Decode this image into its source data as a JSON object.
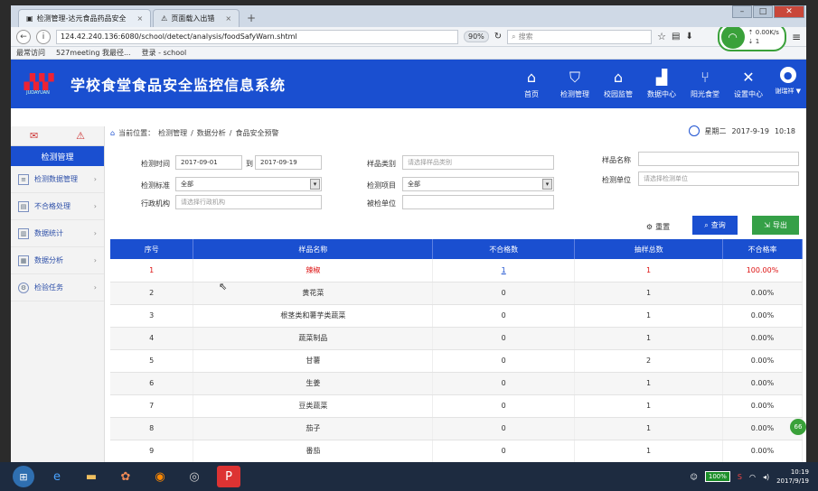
{
  "browser": {
    "tabs": [
      {
        "label": "检测管理-达元食品药品安全"
      },
      {
        "label": "页面载入出错"
      }
    ],
    "url": "124.42.240.136:6080/school/detect/analysis/foodSafyWarn.shtml",
    "zoom": "90%",
    "search_placeholder": "搜索",
    "bookmarks": [
      "最常访问",
      "527meeting 我最径...",
      "登录 - school"
    ],
    "speed_down": "0.00K/s",
    "speed_up": "1"
  },
  "app": {
    "logo_text": "JUDAYUAN",
    "title": "学校食堂食品安全监控信息系统",
    "nav": [
      {
        "label": "首页",
        "icon": "home-icon"
      },
      {
        "label": "检测管理",
        "icon": "shield-icon"
      },
      {
        "label": "校园监管",
        "icon": "school-icon"
      },
      {
        "label": "数据中心",
        "icon": "chart-icon"
      },
      {
        "label": "阳光食堂",
        "icon": "cutlery-icon"
      },
      {
        "label": "设置中心",
        "icon": "tools-icon"
      }
    ],
    "user": "谢瑞祥"
  },
  "sidebar": {
    "title": "检测管理",
    "items": [
      {
        "label": "检测数据管理"
      },
      {
        "label": "不合格处理"
      },
      {
        "label": "数据统计"
      },
      {
        "label": "数据分析"
      },
      {
        "label": "检验任务"
      }
    ]
  },
  "breadcrumb": {
    "prefix": "当前位置：",
    "items": [
      "检测管理",
      "数据分析",
      "食品安全预警"
    ]
  },
  "datetime": {
    "weekday": "星期二",
    "date": "2017-9-19",
    "time": "10:18"
  },
  "filters": {
    "time_label": "检测时间",
    "date_from": "2017-09-01",
    "to_label": "到",
    "date_to": "2017-09-19",
    "standard_label": "检测标准",
    "standard_value": "全部",
    "org_label": "行政机构",
    "org_placeholder": "请选择行政机构",
    "category_label": "样品类别",
    "category_placeholder": "请选择样品类别",
    "item_label": "检测项目",
    "item_value": "全部",
    "inspected_label": "被检单位",
    "inspected_value": "",
    "sample_label": "样品名称",
    "sample_value": "",
    "unit_label": "检测单位",
    "unit_placeholder": "请选择检测单位",
    "reset_label": "重置",
    "query_label": "查询",
    "export_label": "导出"
  },
  "table": {
    "headers": [
      "序号",
      "样品名称",
      "不合格数",
      "抽样总数",
      "不合格率"
    ],
    "rows": [
      {
        "no": "1",
        "name": "辣椒",
        "fail": "1",
        "total": "1",
        "rate": "100.00%"
      },
      {
        "no": "2",
        "name": "黄花菜",
        "fail": "0",
        "total": "1",
        "rate": "0.00%"
      },
      {
        "no": "3",
        "name": "根茎类和薯芋类蔬菜",
        "fail": "0",
        "total": "1",
        "rate": "0.00%"
      },
      {
        "no": "4",
        "name": "蔬菜制品",
        "fail": "0",
        "total": "1",
        "rate": "0.00%"
      },
      {
        "no": "5",
        "name": "甘薯",
        "fail": "0",
        "total": "2",
        "rate": "0.00%"
      },
      {
        "no": "6",
        "name": "生姜",
        "fail": "0",
        "total": "1",
        "rate": "0.00%"
      },
      {
        "no": "7",
        "name": "豆类蔬菜",
        "fail": "0",
        "total": "1",
        "rate": "0.00%"
      },
      {
        "no": "8",
        "name": "茄子",
        "fail": "0",
        "total": "1",
        "rate": "0.00%"
      },
      {
        "no": "9",
        "name": "番茄",
        "fail": "0",
        "total": "1",
        "rate": "0.00%"
      }
    ]
  },
  "side_badge": "66",
  "taskbar": {
    "battery": "100%",
    "time": "10:19",
    "date": "2017/9/19"
  }
}
